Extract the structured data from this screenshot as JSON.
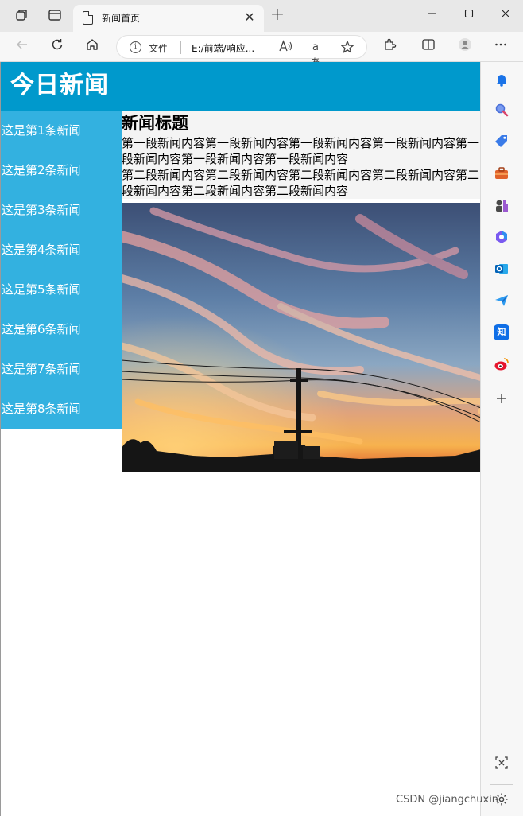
{
  "browser": {
    "tab": {
      "title": "新闻首页",
      "close_glyph": "✕"
    },
    "new_tab_glyph": "+",
    "window_controls": {
      "minimize": "—",
      "maximize": "☐",
      "close": "✕"
    },
    "address_bar": {
      "scheme_label": "文件",
      "url": "E:/前端/响应...",
      "read_aloud_label": "Ă",
      "translate_label": "aあ"
    },
    "icons": [
      "workspaces-icon",
      "tab-actions-icon",
      "page-icon",
      "back-icon",
      "refresh-icon",
      "home-icon",
      "info-icon",
      "read-aloud-icon",
      "favorite-star-icon",
      "extensions-icon",
      "split-screen-icon",
      "profile-icon",
      "more-menu-icon"
    ],
    "sidebar_icons": [
      "bell-icon",
      "search-icon",
      "shopping-tag-icon",
      "toolbox-icon",
      "games-icon",
      "office-icon",
      "outlook-icon",
      "send-icon",
      "zhihu-icon",
      "weibo-icon",
      "add-icon",
      "screenshot-icon",
      "settings-icon"
    ],
    "sidebar_labels": {
      "zhihu": "知"
    }
  },
  "page": {
    "site_title": "今日新闻",
    "news_links": [
      "这是第1条新闻",
      "这是第2条新闻",
      "这是第3条新闻",
      "这是第4条新闻",
      "这是第5条新闻",
      "这是第6条新闻",
      "这是第7条新闻",
      "这是第8条新闻"
    ],
    "article": {
      "title": "新闻标题",
      "paragraphs": [
        "第一段新闻内容第一段新闻内容第一段新闻内容第一段新闻内容第一段新闻内容第一段新闻内容第一段新闻内容",
        "第二段新闻内容第二段新闻内容第二段新闻内容第二段新闻内容第二段新闻内容第二段新闻内容第二段新闻内容"
      ]
    }
  },
  "watermark": "CSDN @jiangchuxin",
  "colors": {
    "header_blue": "#0099cc",
    "nav_blue": "#33b1e0",
    "article_bg": "#f4f4f4"
  }
}
